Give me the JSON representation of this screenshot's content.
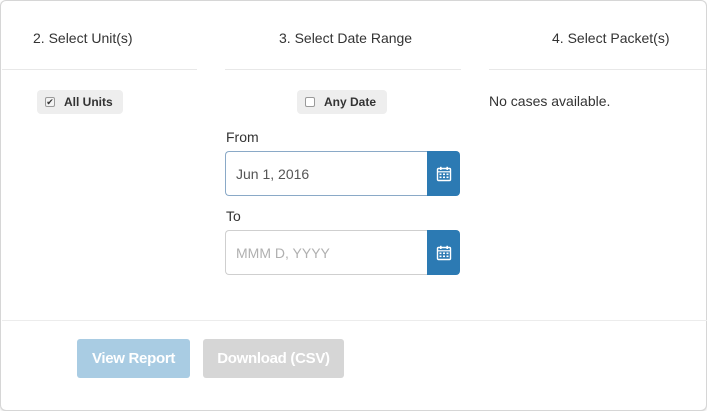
{
  "headers": {
    "unit": "2. Select Unit(s)",
    "date": "3. Select Date Range",
    "packet": "4. Select Packet(s)"
  },
  "units": {
    "all_units_label": "All Units",
    "all_units_checked": true
  },
  "date_range": {
    "any_date_label": "Any Date",
    "any_date_checked": false,
    "from_label": "From",
    "from_value": "Jun 1, 2016",
    "to_label": "To",
    "to_placeholder": "MMM D, YYYY"
  },
  "packets": {
    "empty_message": "No cases available."
  },
  "actions": {
    "view_report_label": "View Report",
    "download_csv_label": "Download (CSV)"
  },
  "colors": {
    "accent": "#2c7ab3",
    "view_report_disabled": "#a9cce3",
    "download_disabled": "#d6d6d6"
  },
  "icons": {
    "calendar": "calendar-icon",
    "check": "checkmark-icon"
  }
}
